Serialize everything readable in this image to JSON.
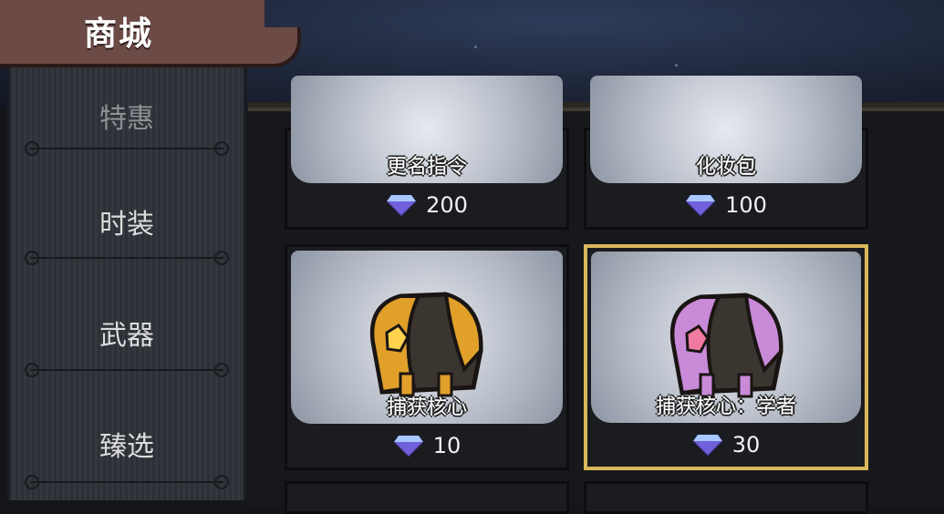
{
  "title": "商城",
  "sidebar": {
    "items": [
      {
        "label": "特惠"
      },
      {
        "label": "时装"
      },
      {
        "label": "武器"
      },
      {
        "label": "臻选"
      }
    ]
  },
  "shop": {
    "items": [
      {
        "name": "更名指令",
        "price": "200",
        "currency_icon": "diamond-icon"
      },
      {
        "name": "化妆包",
        "price": "100",
        "currency_icon": "diamond-icon"
      },
      {
        "name": "捕获核心",
        "price": "10",
        "currency_icon": "diamond-icon",
        "accent": "#e0a02a"
      },
      {
        "name": "捕获核心：学者",
        "price": "30",
        "currency_icon": "diamond-icon",
        "accent": "#c98ad8",
        "selected": true
      }
    ]
  },
  "colors": {
    "banner": "#6c4a46",
    "selected_border": "#d8b85a",
    "gem": "#6f7fe8"
  }
}
